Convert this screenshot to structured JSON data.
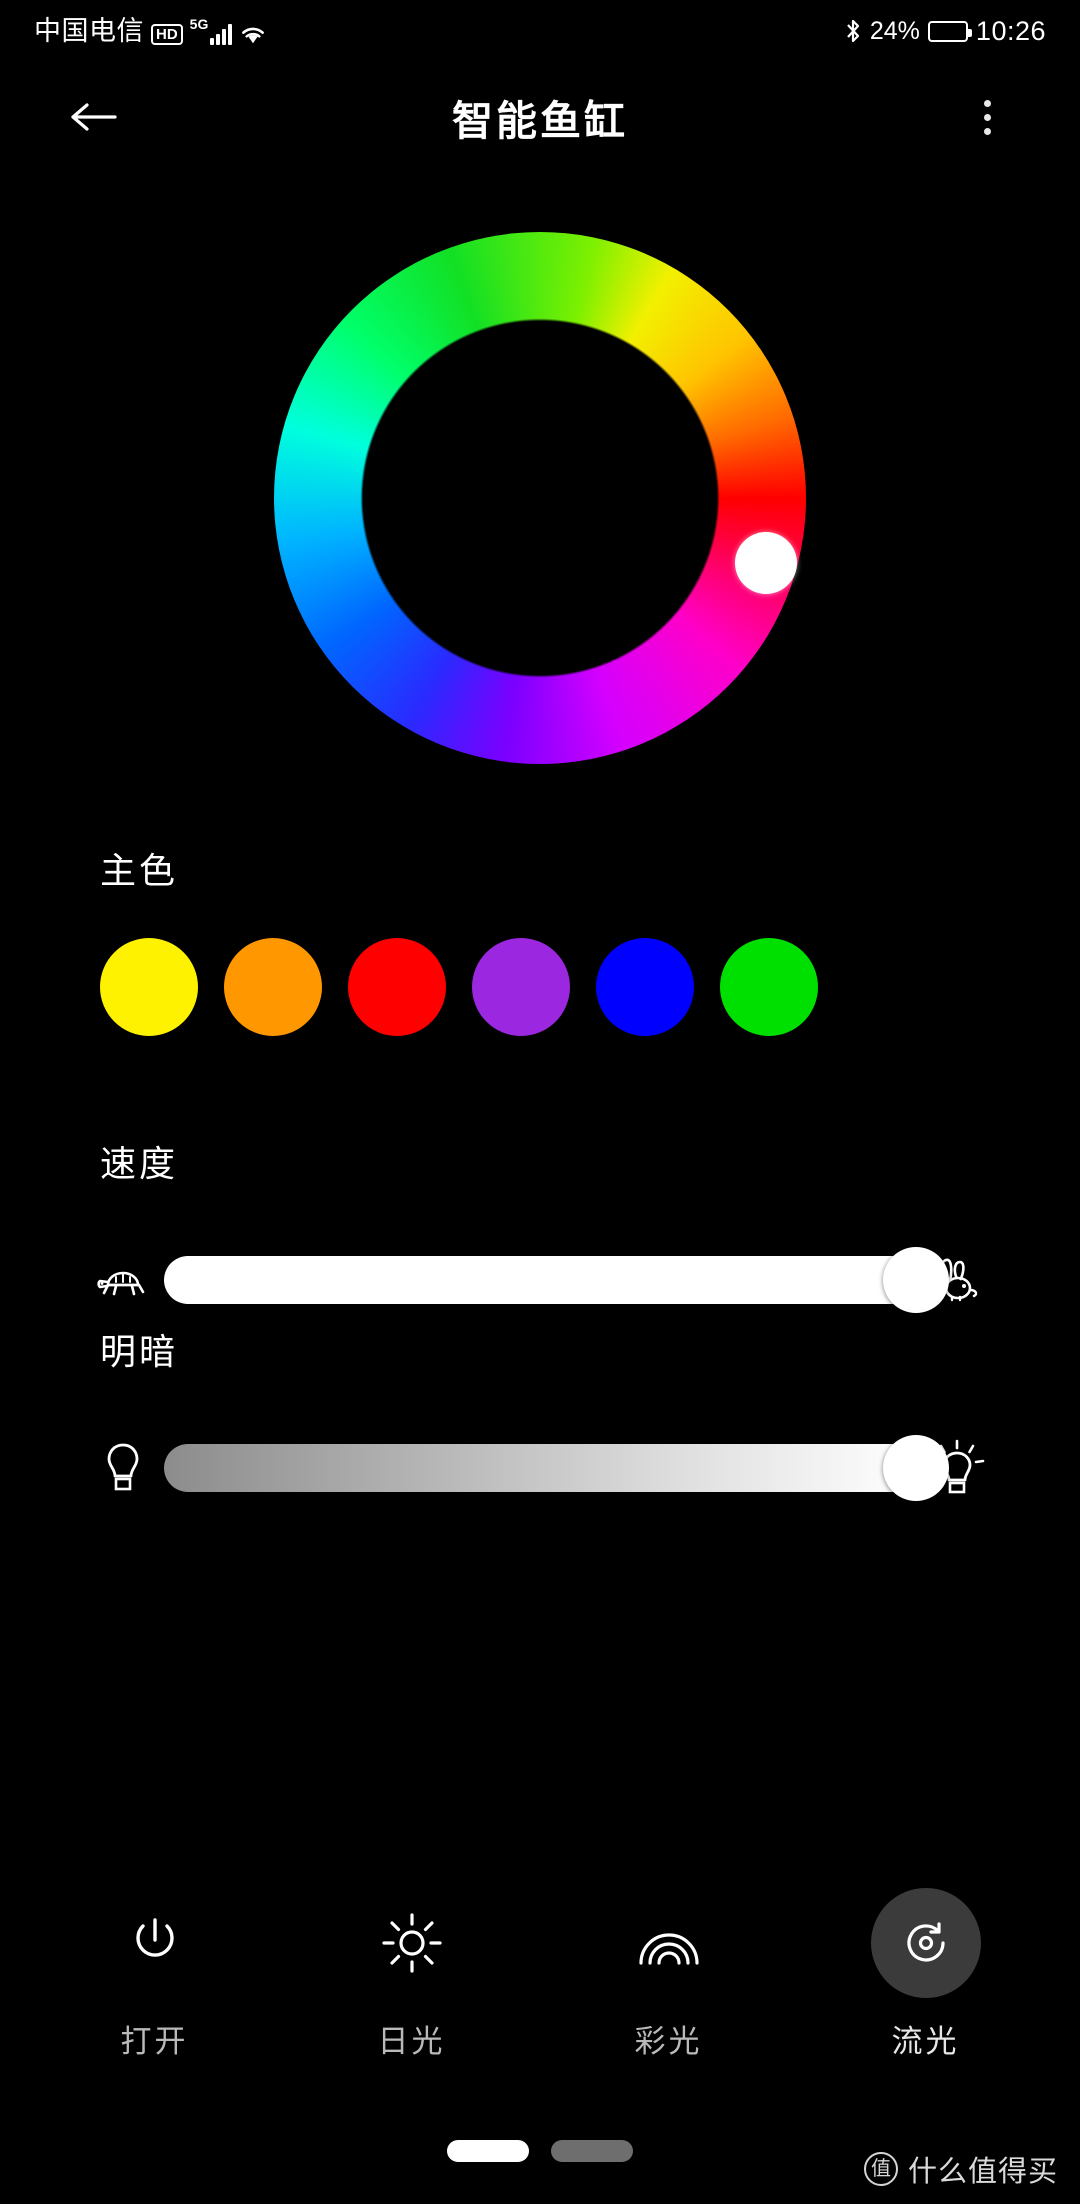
{
  "status_bar": {
    "carrier": "中国电信",
    "hd_badge": "HD",
    "network": "5G",
    "wifi_icon": "wifi-icon",
    "bluetooth_icon": "bluetooth-icon",
    "battery_percent": "24%",
    "battery_level": 24,
    "clock": "10:26"
  },
  "app_bar": {
    "back_icon": "back-arrow-icon",
    "title": "智能鱼缸",
    "menu_icon": "more-vertical-icon"
  },
  "color_wheel": {
    "name": "color-wheel",
    "handle_label": "color-wheel-handle",
    "handle_angle_deg": 8,
    "selected_color": "#ff2a18"
  },
  "main_color": {
    "label": "主色",
    "swatches": [
      {
        "name": "swatch-yellow",
        "color": "#fff200"
      },
      {
        "name": "swatch-orange",
        "color": "#ff9800"
      },
      {
        "name": "swatch-red",
        "color": "#ff0000"
      },
      {
        "name": "swatch-purple",
        "color": "#9c27e0"
      },
      {
        "name": "swatch-blue",
        "color": "#0000ff"
      },
      {
        "name": "swatch-green",
        "color": "#00e000"
      }
    ]
  },
  "speed": {
    "label": "速度",
    "left_icon": "turtle-icon",
    "right_icon": "rabbit-icon",
    "value": 100
  },
  "brightness": {
    "label": "明暗",
    "left_icon": "dim-bulb-icon",
    "right_icon": "bright-bulb-icon",
    "value": 100
  },
  "bottom_bar": {
    "items": [
      {
        "label": "打开",
        "icon": "power-icon",
        "active": false
      },
      {
        "label": "日光",
        "icon": "sun-icon",
        "active": false
      },
      {
        "label": "彩光",
        "icon": "rainbow-icon",
        "active": false
      },
      {
        "label": "流光",
        "icon": "flowing-light-icon",
        "active": true
      }
    ]
  },
  "home_indicator": {
    "left_pill": "home-pill-white",
    "right_pill": "home-pill-gray"
  },
  "watermark": {
    "logo_char": "值",
    "text": "什么值得买"
  },
  "colors": {
    "background": "#000000",
    "text_primary": "#ffffff",
    "text_secondary": "#b9b9b9",
    "active_button_bg": "#3b3b3b"
  }
}
